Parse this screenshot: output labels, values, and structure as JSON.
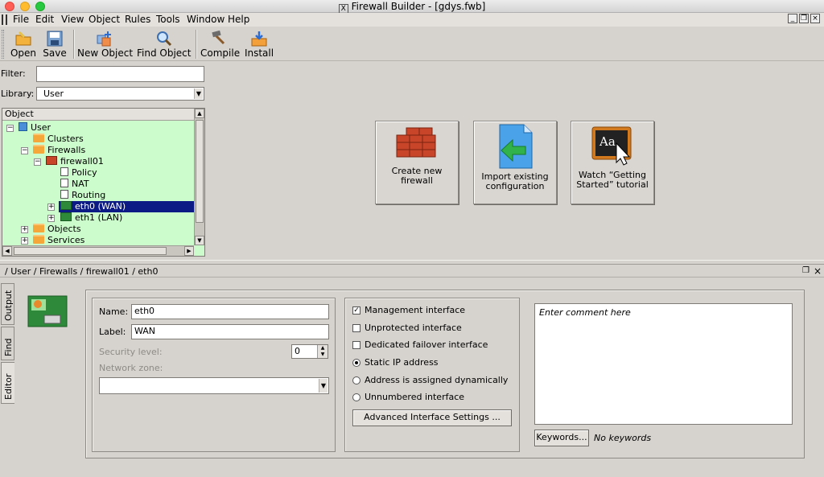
{
  "window": {
    "title": "Firewall Builder - [gdys.fwb]",
    "colors": {
      "close": "#ff5f57",
      "minimize": "#febc2e",
      "zoom": "#28c840"
    }
  },
  "menu": [
    "File",
    "Edit",
    "View",
    "Object",
    "Rules",
    "Tools",
    "Window",
    "Help"
  ],
  "toolbar": {
    "open": "Open",
    "save": "Save",
    "new_object": "New Object",
    "find_object": "Find Object",
    "compile": "Compile",
    "install": "Install"
  },
  "left_panel": {
    "filter_label": "Filter:",
    "filter_value": "",
    "library_label": "Library:",
    "library_value": "User",
    "tree_header": "Object",
    "tree": [
      {
        "label": "User",
        "icon": "library-icon"
      },
      {
        "label": "Clusters",
        "icon": "folder-icon"
      },
      {
        "label": "Firewalls",
        "icon": "folder-icon"
      },
      {
        "label": "firewall01",
        "icon": "firewall-icon"
      },
      {
        "label": "Policy",
        "icon": "policy-icon"
      },
      {
        "label": "NAT",
        "icon": "nat-icon"
      },
      {
        "label": "Routing",
        "icon": "routing-icon"
      },
      {
        "label": "eth0 (WAN)",
        "icon": "interface-icon",
        "selected": true
      },
      {
        "label": "eth1 (LAN)",
        "icon": "interface-icon"
      },
      {
        "label": "Objects",
        "icon": "folder-icon"
      },
      {
        "label": "Services",
        "icon": "folder-icon"
      }
    ]
  },
  "welcome": {
    "create_firewall": [
      "Create new",
      "firewall"
    ],
    "import_config": [
      "Import existing",
      "configuration"
    ],
    "watch_tutorial": [
      "Watch “Getting",
      "Started” tutorial"
    ]
  },
  "dock": {
    "breadcrumb": "/ User / Firewalls / firewall01 / eth0",
    "tabs": [
      "Output",
      "Find",
      "Editor"
    ]
  },
  "editor": {
    "name_label": "Name:",
    "name_value": "eth0",
    "label_label": "Label:",
    "label_value": "WAN",
    "security_level_label": "Security level:",
    "security_level_value": "0",
    "network_zone_label": "Network zone:",
    "network_zone_value": "",
    "options": {
      "management": {
        "label": "Management interface",
        "checked": true
      },
      "unprotected": {
        "label": "Unprotected interface",
        "checked": false
      },
      "failover": {
        "label": "Dedicated failover interface",
        "checked": false
      }
    },
    "address_mode": {
      "static": {
        "label": "Static IP address",
        "selected": true
      },
      "dynamic": {
        "label": "Address is assigned dynamically",
        "selected": false
      },
      "unnumbered": {
        "label": "Unnumbered interface",
        "selected": false
      }
    },
    "advanced_button": "Advanced Interface Settings ...",
    "comment_placeholder": "Enter comment here",
    "keywords_button": "Keywords...",
    "keywords_value": "No keywords"
  }
}
